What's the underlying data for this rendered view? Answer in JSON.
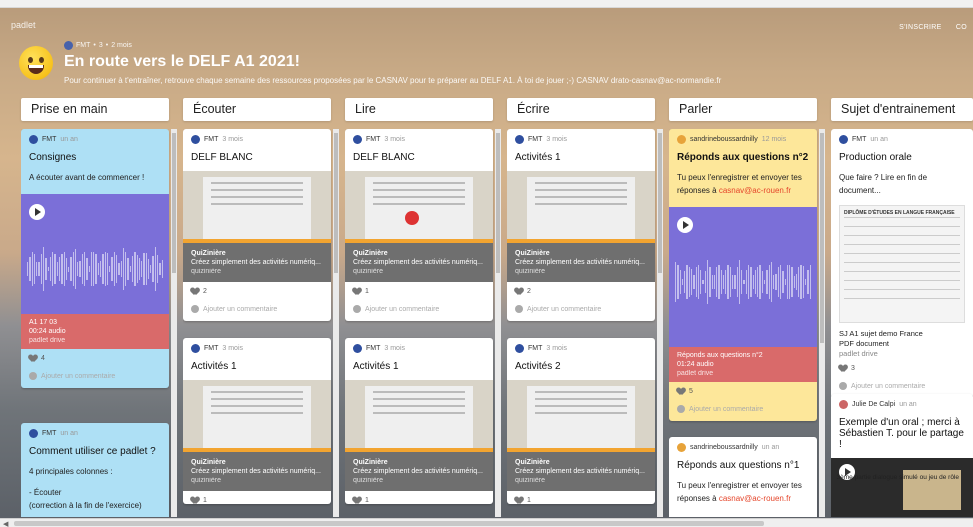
{
  "padlet": {
    "brand": "padlet",
    "top_right": [
      "S'INSCRIRE",
      "CO"
    ],
    "author": "FMT",
    "meta_sep": "•",
    "meta_count": "3",
    "meta_time": "2 mois",
    "title": "En route vers le DELF A1 2021!",
    "subtitle": "Pour continuer à t'entraîner, retrouve chaque semaine des ressources proposées par le CASNAV pour te préparer au DELF A1. À toi de jouer ;-) CASNAV drato-casnav@ac-normandie.fr"
  },
  "columns": [
    "Prise en main",
    "Écouter",
    "Lire",
    "Écrire",
    "Parler",
    "Sujet d'entrainement"
  ],
  "cards": {
    "c1": {
      "author": "FMT",
      "time": "un an",
      "title": "Consignes",
      "body": "A écouter avant de commencer !",
      "audio_title": "A1 17 03",
      "audio_len": "00:24 audio",
      "audio_src": "padlet drive",
      "likes": "4",
      "comment": "Ajouter un commentaire"
    },
    "c1b": {
      "author": "FMT",
      "time": "un an",
      "title": "Comment utiliser ce padlet ?",
      "body": "4 principales colonnes :",
      "b1": "- Écouter",
      "b2": "(correction à la fin de l'exercice)"
    },
    "c2": {
      "author": "FMT",
      "time": "3 mois",
      "title": "DELF BLANC",
      "link_h": "QuiZinière",
      "link_s": "Créez simplement des activités numériq...",
      "link_src": "quizinière",
      "likes": "2",
      "comment": "Ajouter un commentaire"
    },
    "c2b": {
      "author": "FMT",
      "time": "3 mois",
      "title": "Activités 1",
      "link_h": "QuiZinière",
      "link_s": "Créez simplement des activités numériq...",
      "link_src": "quizinière",
      "likes": "1"
    },
    "c3": {
      "author": "FMT",
      "time": "3 mois",
      "title": "DELF BLANC",
      "link_h": "QuiZinière",
      "link_s": "Créez simplement des activités numériq...",
      "link_src": "quizinière",
      "likes": "1",
      "comment": "Ajouter un commentaire"
    },
    "c3b": {
      "author": "FMT",
      "time": "3 mois",
      "title": "Activités 1",
      "link_h": "QuiZinière",
      "link_s": "Créez simplement des activités numériq...",
      "link_src": "quizinière",
      "likes": "1"
    },
    "c4": {
      "author": "FMT",
      "time": "3 mois",
      "title": "Activités 1",
      "link_h": "QuiZinière",
      "link_s": "Créez simplement des activités numériq...",
      "link_src": "quizinière",
      "likes": "2",
      "comment": "Ajouter un commentaire"
    },
    "c4b": {
      "author": "FMT",
      "time": "3 mois",
      "title": "Activités 2",
      "link_h": "QuiZinière",
      "link_s": "Créez simplement des activités numériq...",
      "link_src": "quizinière",
      "likes": "1"
    },
    "c5": {
      "author": "sandrineboussardnilly",
      "time": "12 mois",
      "title": "Réponds aux questions n°2",
      "body": "Tu peux l'enregistrer et envoyer tes réponses à",
      "mail": "casnav@ac-rouen.fr",
      "audio_title": "Réponds aux questions n°2",
      "audio_len": "01:24 audio",
      "audio_src": "padlet drive",
      "likes": "5",
      "comment": "Ajouter un commentaire"
    },
    "c5b": {
      "author": "sandrineboussardnilly",
      "time": "un an",
      "title": "Réponds aux questions n°1",
      "body": "Tu peux l'enregistrer et envoyer tes réponses à",
      "mail": "casnav@ac-rouen.fr"
    },
    "c6": {
      "author": "FMT",
      "time": "un an",
      "title": "Production orale",
      "body": "Que faire ? Lire en fin de document...",
      "pdf_head": "DIPLÔME D'ÉTUDES EN LANGUE FRANÇAISE",
      "pdf_title": "SJ A1 sujet demo France",
      "pdf_type": "PDF document",
      "pdf_src": "padlet drive",
      "likes": "3",
      "comment": "Ajouter un commentaire"
    },
    "c6b": {
      "author": "Julie De Calpi",
      "time": "un an",
      "title": "Exemple d'un oral ; merci à Sébastien T. pour le partage !",
      "video_tag": "3ème partie dialogue simulé ou jeu de rôle"
    }
  },
  "colors": {
    "blue_card": "#aee0f5",
    "yellow_card": "#fde79a",
    "audio_bg": "#7b6fd8",
    "audio_caption": "#d96a6a",
    "link_red": "#e5452a"
  },
  "icons": [
    "smiling-emoji-icon",
    "play-icon",
    "heart-icon",
    "comment-icon",
    "avatar-icon"
  ]
}
